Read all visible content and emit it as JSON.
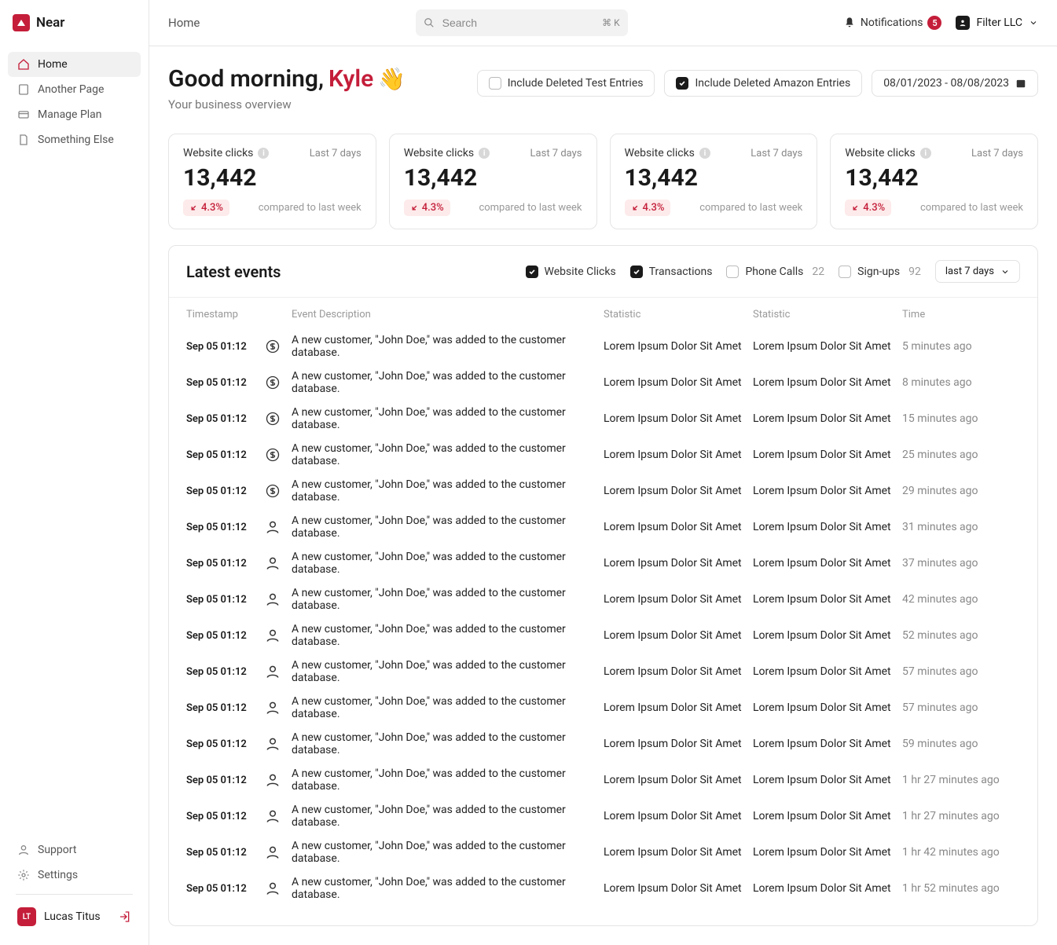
{
  "brand": "Near",
  "breadcrumb": "Home",
  "search": {
    "placeholder": "Search",
    "kbd": "⌘ K"
  },
  "notifications": {
    "label": "Notifications",
    "count": "5"
  },
  "org": {
    "name": "Filter LLC"
  },
  "sidebar": {
    "items": [
      {
        "label": "Home"
      },
      {
        "label": "Another Page"
      },
      {
        "label": "Manage Plan"
      },
      {
        "label": "Something Else"
      }
    ],
    "footer": {
      "support": "Support",
      "settings": "Settings"
    },
    "user": {
      "initials": "LT",
      "name": "Lucas Titus"
    }
  },
  "greeting": {
    "prefix": "Good morning, ",
    "name": "Kyle",
    "emoji": "👋"
  },
  "subtitle": "Your business overview",
  "headerControls": {
    "includeTest": "Include Deleted Test Entries",
    "includeAmazon": "Include Deleted Amazon Entries",
    "dateRange": "08/01/2023 - 08/08/2023"
  },
  "cards": [
    {
      "title": "Website clicks",
      "period": "Last 7 days",
      "value": "13,442",
      "delta": "4.3%",
      "compare": "compared to last week"
    },
    {
      "title": "Website clicks",
      "period": "Last 7 days",
      "value": "13,442",
      "delta": "4.3%",
      "compare": "compared to last week"
    },
    {
      "title": "Website clicks",
      "period": "Last 7 days",
      "value": "13,442",
      "delta": "4.3%",
      "compare": "compared to last week"
    },
    {
      "title": "Website clicks",
      "period": "Last 7 days",
      "value": "13,442",
      "delta": "4.3%",
      "compare": "compared to last week"
    }
  ],
  "events": {
    "title": "Latest events",
    "filters": {
      "websiteClicks": "Website Clicks",
      "transactions": "Transactions",
      "phoneCalls": "Phone Calls",
      "phoneCallsCount": "22",
      "signups": "Sign-ups",
      "signupsCount": "92",
      "range": "last 7 days"
    },
    "columns": {
      "timestamp": "Timestamp",
      "description": "Event Description",
      "stat1": "Statistic",
      "stat2": "Statistic",
      "time": "Time"
    },
    "rows": [
      {
        "ts": "Sep 05 01:12",
        "icon": "dollar",
        "desc": "A new customer, \"John Doe,\" was added to the customer database.",
        "s1": "Lorem Ipsum Dolor Sit Amet",
        "s2": "Lorem Ipsum Dolor Sit Amet",
        "time": "5 minutes ago"
      },
      {
        "ts": "Sep 05 01:12",
        "icon": "dollar",
        "desc": "A new customer, \"John Doe,\" was added to the customer database.",
        "s1": "Lorem Ipsum Dolor Sit Amet",
        "s2": "Lorem Ipsum Dolor Sit Amet",
        "time": "8 minutes ago"
      },
      {
        "ts": "Sep 05 01:12",
        "icon": "dollar",
        "desc": "A new customer, \"John Doe,\" was added to the customer database.",
        "s1": "Lorem Ipsum Dolor Sit Amet",
        "s2": "Lorem Ipsum Dolor Sit Amet",
        "time": "15 minutes ago"
      },
      {
        "ts": "Sep 05 01:12",
        "icon": "dollar",
        "desc": "A new customer, \"John Doe,\" was added to the customer database.",
        "s1": "Lorem Ipsum Dolor Sit Amet",
        "s2": "Lorem Ipsum Dolor Sit Amet",
        "time": "25 minutes ago"
      },
      {
        "ts": "Sep 05 01:12",
        "icon": "dollar",
        "desc": "A new customer, \"John Doe,\" was added to the customer database.",
        "s1": "Lorem Ipsum Dolor Sit Amet",
        "s2": "Lorem Ipsum Dolor Sit Amet",
        "time": "29 minutes ago"
      },
      {
        "ts": "Sep 05 01:12",
        "icon": "user",
        "desc": "A new customer, \"John Doe,\" was added to the customer database.",
        "s1": "Lorem Ipsum Dolor Sit Amet",
        "s2": "Lorem Ipsum Dolor Sit Amet",
        "time": "31 minutes ago"
      },
      {
        "ts": "Sep 05 01:12",
        "icon": "user",
        "desc": "A new customer, \"John Doe,\" was added to the customer database.",
        "s1": "Lorem Ipsum Dolor Sit Amet",
        "s2": "Lorem Ipsum Dolor Sit Amet",
        "time": "37 minutes ago"
      },
      {
        "ts": "Sep 05 01:12",
        "icon": "user",
        "desc": "A new customer, \"John Doe,\" was added to the customer database.",
        "s1": "Lorem Ipsum Dolor Sit Amet",
        "s2": "Lorem Ipsum Dolor Sit Amet",
        "time": "42 minutes ago"
      },
      {
        "ts": "Sep 05 01:12",
        "icon": "user",
        "desc": "A new customer, \"John Doe,\" was added to the customer database.",
        "s1": "Lorem Ipsum Dolor Sit Amet",
        "s2": "Lorem Ipsum Dolor Sit Amet",
        "time": "52 minutes ago"
      },
      {
        "ts": "Sep 05 01:12",
        "icon": "user",
        "desc": "A new customer, \"John Doe,\" was added to the customer database.",
        "s1": "Lorem Ipsum Dolor Sit Amet",
        "s2": "Lorem Ipsum Dolor Sit Amet",
        "time": "57 minutes ago"
      },
      {
        "ts": "Sep 05 01:12",
        "icon": "user",
        "desc": "A new customer, \"John Doe,\" was added to the customer database.",
        "s1": "Lorem Ipsum Dolor Sit Amet",
        "s2": "Lorem Ipsum Dolor Sit Amet",
        "time": "57 minutes ago"
      },
      {
        "ts": "Sep 05 01:12",
        "icon": "user",
        "desc": "A new customer, \"John Doe,\" was added to the customer database.",
        "s1": "Lorem Ipsum Dolor Sit Amet",
        "s2": "Lorem Ipsum Dolor Sit Amet",
        "time": "59 minutes ago"
      },
      {
        "ts": "Sep 05 01:12",
        "icon": "user",
        "desc": "A new customer, \"John Doe,\" was added to the customer database.",
        "s1": "Lorem Ipsum Dolor Sit Amet",
        "s2": "Lorem Ipsum Dolor Sit Amet",
        "time": "1 hr 27 minutes ago"
      },
      {
        "ts": "Sep 05 01:12",
        "icon": "user",
        "desc": "A new customer, \"John Doe,\" was added to the customer database.",
        "s1": "Lorem Ipsum Dolor Sit Amet",
        "s2": "Lorem Ipsum Dolor Sit Amet",
        "time": "1 hr 27 minutes ago"
      },
      {
        "ts": "Sep 05 01:12",
        "icon": "user",
        "desc": "A new customer, \"John Doe,\" was added to the customer database.",
        "s1": "Lorem Ipsum Dolor Sit Amet",
        "s2": "Lorem Ipsum Dolor Sit Amet",
        "time": "1 hr 42 minutes ago"
      },
      {
        "ts": "Sep 05 01:12",
        "icon": "user",
        "desc": "A new customer, \"John Doe,\" was added to the customer database.",
        "s1": "Lorem Ipsum Dolor Sit Amet",
        "s2": "Lorem Ipsum Dolor Sit Amet",
        "time": "1 hr 52 minutes ago"
      }
    ]
  }
}
